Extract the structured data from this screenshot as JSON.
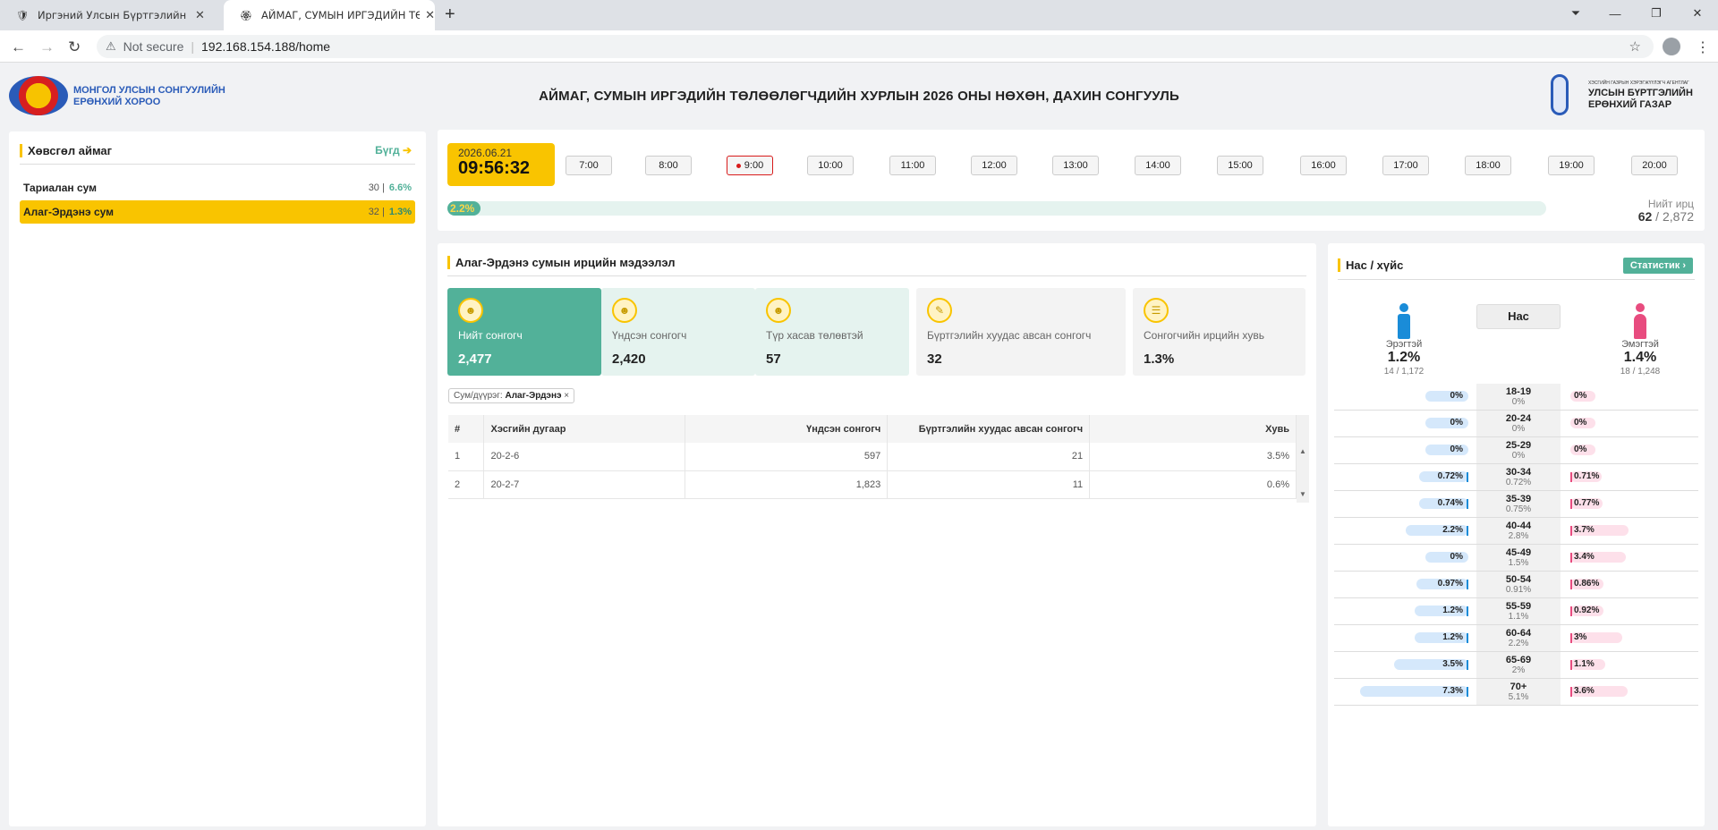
{
  "browser": {
    "tabs": [
      {
        "title": "Иргэний Улсын Бүртгэлийн Сис"
      },
      {
        "title": "АЙМАГ, СУМЫН ИРГЭДИЙН ТӨ"
      }
    ],
    "not_secure": "Not secure",
    "url": "192.168.154.188/home"
  },
  "header": {
    "left_org_line1": "МОНГОЛ УЛСЫН СОНГУУЛИЙН",
    "left_org_line2": "ЕРӨНХИЙ ХОРОО",
    "title": "АЙМАГ, СУМЫН ИРГЭДИЙН ТӨЛӨӨЛӨГЧДИЙН ХУРЛЫН 2026 ОНЫ НӨХӨН, ДАХИН СОНГУУЛЬ",
    "right_org_small": "ХЭСГИЙН ГАЗРЫН ХЭРЭГЖҮҮЛЭГЧ АГЕНТЛАГ",
    "right_org_line1": "УЛСЫН БҮРТГЭЛИЙН",
    "right_org_line2": "ЕРӨНХИЙ ГАЗАР"
  },
  "left_panel": {
    "title": "Хөвсгөл аймаг",
    "back_label": "Бүгд",
    "sums": [
      {
        "name": "Тариалан сум",
        "count": "30",
        "pct": "6.6%"
      },
      {
        "name": "Алаг-Эрдэнэ сум",
        "count": "32",
        "pct": "1.3%"
      }
    ]
  },
  "time": {
    "date": "2026.06.21",
    "clock": "09:56:32",
    "hours": [
      "7:00",
      "8:00",
      "9:00",
      "10:00",
      "11:00",
      "12:00",
      "13:00",
      "14:00",
      "15:00",
      "16:00",
      "17:00",
      "18:00",
      "19:00",
      "20:00"
    ],
    "current_hour": "9:00",
    "progress_label": "2.2%",
    "progress_fraction": 0.022,
    "total_label": "Нийт ирц",
    "total_current": "62",
    "total_sep": " / ",
    "total_max": "2,872"
  },
  "info": {
    "title": "Алаг-Эрдэнэ сумын ирцийн мэдээлэл",
    "stats": [
      {
        "label": "Нийт сонгогч",
        "value": "2,477"
      },
      {
        "label": "Үндсэн сонгогч",
        "value": "2,420"
      },
      {
        "label": "Түр хасав төлөвтэй",
        "value": "57"
      },
      {
        "label": "Бүртгэлийн хуудас авсан сонгогч",
        "value": "32"
      },
      {
        "label": "Сонгогчийн ирцийн хувь",
        "value": "1.3%"
      }
    ],
    "filter_label": "Сум/дүүрэг:",
    "filter_value": "Алаг-Эрдэнэ",
    "filter_close": "×",
    "table_headers": [
      "#",
      "Хэсгийн дугаар",
      "Үндсэн сонгогч",
      "Бүртгэлийн хуудас авсан сонгогч",
      "Хувь"
    ],
    "rows": [
      [
        "1",
        "20-2-6",
        "597",
        "21",
        "3.5%"
      ],
      [
        "2",
        "20-2-7",
        "1,823",
        "11",
        "0.6%"
      ]
    ]
  },
  "age": {
    "title": "Нас / хүйс",
    "stat_button": "Статистик",
    "age_header": "Нас",
    "male": {
      "label": "Эрэгтэй",
      "pct": "1.2%",
      "count": "14 / 1,172"
    },
    "female": {
      "label": "Эмэгтэй",
      "pct": "1.4%",
      "count": "18 / 1,248"
    },
    "rows": [
      {
        "range": "18-19",
        "total": "0%",
        "male": "0%",
        "female": "0%"
      },
      {
        "range": "20-24",
        "total": "0%",
        "male": "0%",
        "female": "0%"
      },
      {
        "range": "25-29",
        "total": "0%",
        "male": "0%",
        "female": "0%"
      },
      {
        "range": "30-34",
        "total": "0.72%",
        "male": "0.72%",
        "female": "0.71%"
      },
      {
        "range": "35-39",
        "total": "0.75%",
        "male": "0.74%",
        "female": "0.77%"
      },
      {
        "range": "40-44",
        "total": "2.8%",
        "male": "2.2%",
        "female": "3.7%"
      },
      {
        "range": "45-49",
        "total": "1.5%",
        "male": "0%",
        "female": "3.4%"
      },
      {
        "range": "50-54",
        "total": "0.91%",
        "male": "0.97%",
        "female": "0.86%"
      },
      {
        "range": "55-59",
        "total": "1.1%",
        "male": "1.2%",
        "female": "0.92%"
      },
      {
        "range": "60-64",
        "total": "2.2%",
        "male": "1.2%",
        "female": "3%"
      },
      {
        "range": "65-69",
        "total": "2%",
        "male": "3.5%",
        "female": "1.1%"
      },
      {
        "range": "70+",
        "total": "5.1%",
        "male": "7.3%",
        "female": "3.6%"
      }
    ],
    "colors": {
      "male": "#1a8cd8",
      "female": "#e84c7f"
    }
  }
}
